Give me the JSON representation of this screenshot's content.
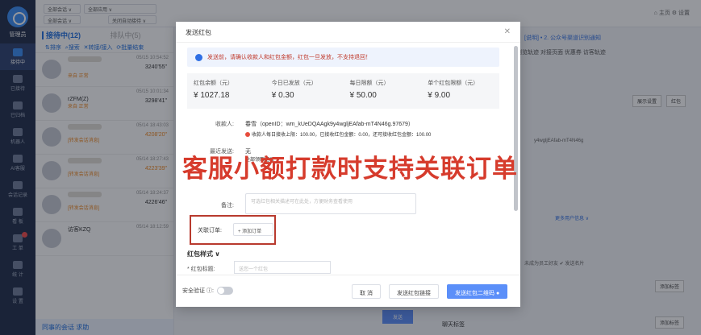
{
  "nav": {
    "manager": "管理员",
    "items": [
      {
        "label": "接待中",
        "active": true
      },
      {
        "label": "已接待"
      },
      {
        "label": "已归档"
      },
      {
        "label": "机器人"
      },
      {
        "label": "AI客服"
      },
      {
        "label": "会话记录"
      },
      {
        "label": "看 板"
      },
      {
        "label": "工 单",
        "badge": true
      },
      {
        "label": "统 计"
      },
      {
        "label": "设 置"
      }
    ]
  },
  "topbar": {
    "sel1": "全部会话 ∨",
    "sel2": "全部应用 ∨",
    "sel3": "关闭自动接待 ∨",
    "right": "⌂ 主页  ⚙ 设置"
  },
  "list": {
    "tab_active": "接待中(12)",
    "tab_other": "排队中(5)",
    "tools": "⇅排序  ⌕搜索  ✕转接/接入  ⟳批量结束",
    "sessions": [
      {
        "time": "05/15 10:54:52",
        "dur": "3240'55\"",
        "tag": "来自 正常",
        "name": ""
      },
      {
        "time": "05/15 10:01:34",
        "dur": "3298'41\"",
        "tag": "来自 正常",
        "name": "rZFM(Z)"
      },
      {
        "time": "05/14 18:43:03",
        "dur": "4208'20\"",
        "tag": "[转发会话消息]",
        "name": ""
      },
      {
        "time": "05/14 18:27:43",
        "dur": "4223'39\"",
        "tag": "[转发会话消息]",
        "name": ""
      },
      {
        "time": "05/14 18:24:37",
        "dur": "4226'46\"",
        "tag": "[转发会话消息]",
        "name": ""
      },
      {
        "time": "05/14 18:12:59",
        "dur": "",
        "tag": "",
        "name": "访客KZQ"
      }
    ],
    "footer": "同事的会话  求助"
  },
  "right": {
    "tabs": "浏览轨迹  对接页面  优惠券  访客轨迹",
    "notice": "[说明] • 2. 公众号渠道识别通知",
    "btn1": "展示设置",
    "btn2": "红包",
    "openid": "y4wgljEAfab-mT4N46g",
    "more": "更多用户信息 ∨",
    "staff": "未成为员工好友  ✔ 发送名片",
    "tag_btn": "添加标签",
    "chat_tags": "聊天标签",
    "send": "发送"
  },
  "modal": {
    "title": "发送红包",
    "notice": "发送前，请确认收款人和红包金额，红包一旦发放，不支持退回！",
    "stats": [
      {
        "label": "红包余额（元）",
        "value": "¥ 1027.18"
      },
      {
        "label": "今日已发放（元）",
        "value": "¥ 0.30"
      },
      {
        "label": "每日限额（元）",
        "value": "¥ 50.00"
      },
      {
        "label": "单个红包限额（元）",
        "value": "¥ 9.00"
      }
    ],
    "recipient_label": "收款人:",
    "recipient_value": "春雪（openID：wm_kUeDQAAgk9y4wgljEAfab-mT4N46g.97679）",
    "recipient_warn": "收款人每日接收上限：100.00，已接收红包金额：0.00，还可接收红包金额：100.00",
    "recent_label": "最近发送:",
    "recent_value": "无",
    "recent_link": "全部领取记录",
    "remark_label": "备注:",
    "remark_placeholder": "可选红包相关描述可在此处，方便财务查看使用",
    "order_label": "关联订单:",
    "order_add": "+ 添加订单",
    "style_section": "红包样式 ∨",
    "greet_label": "* 红包标题:",
    "greet_placeholder": "送您一个红包",
    "safe_label": "安全验证 ⓘ:",
    "cancel": "取 消",
    "send_link": "发送红包链接",
    "send_qr": "发送红包二维码 ●"
  },
  "caption": "客服小额打款时支持关联订单"
}
